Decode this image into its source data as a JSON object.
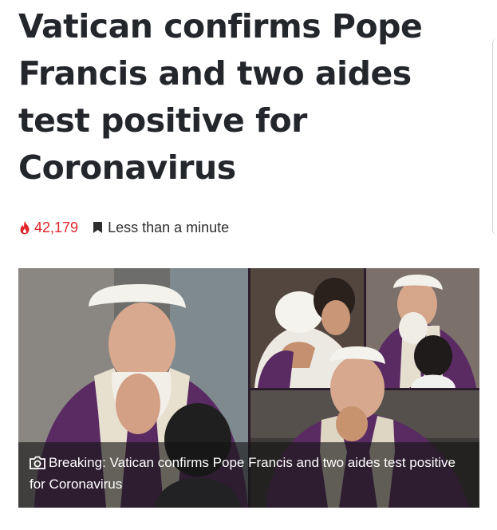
{
  "article": {
    "title": "Vatican confirms Pope Francis and two aides test positive for Coronavirus",
    "views": "42,179",
    "read_time": "Less than a minute",
    "caption": "Breaking: Vatican confirms Pope Francis and two aides test positive for Coronavirus"
  },
  "icons": {
    "views": "fire-icon",
    "read_time": "bookmark-icon",
    "caption": "camera-icon"
  },
  "colors": {
    "headline": "#23262b",
    "views": "#e0252b",
    "vestment": "#5a2a63"
  }
}
